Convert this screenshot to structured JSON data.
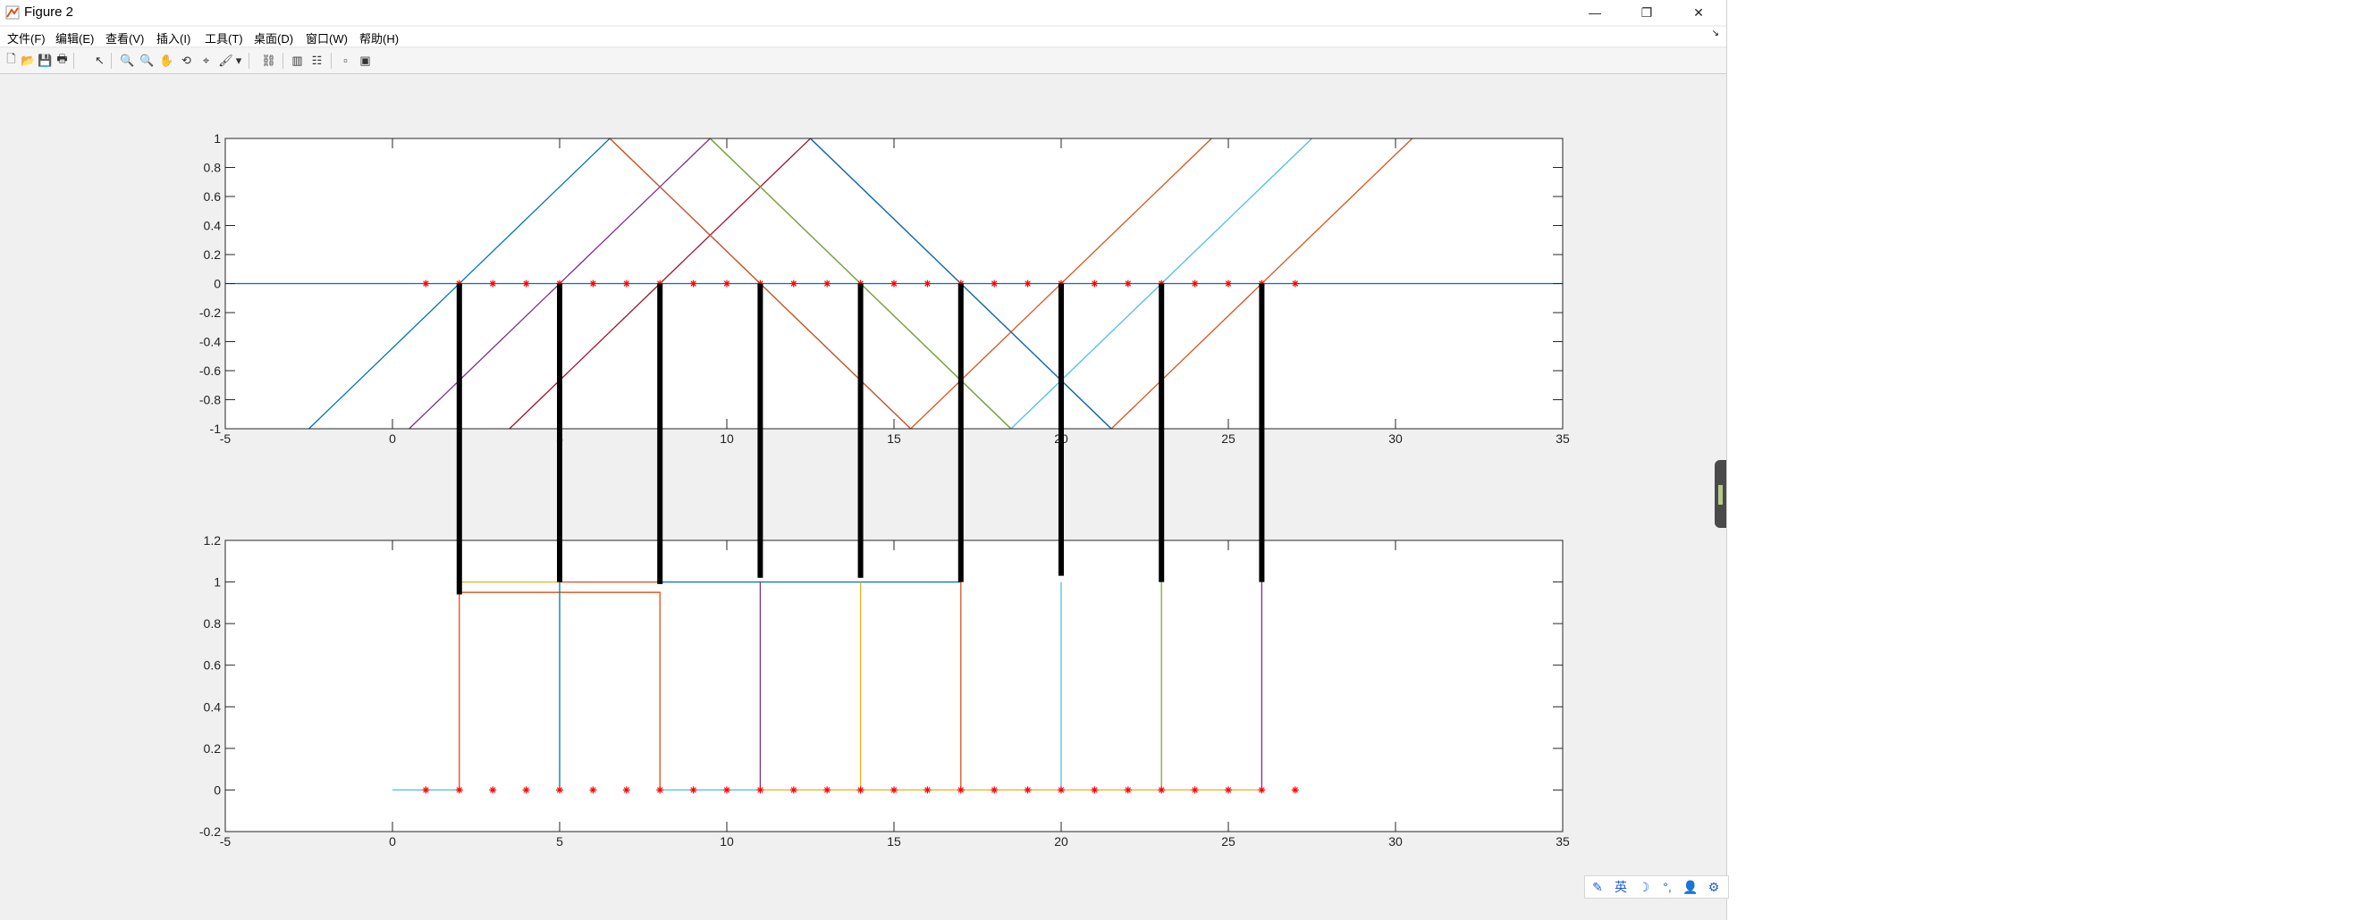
{
  "window": {
    "title": "Figure 2",
    "controls": {
      "minimize": "—",
      "restore": "❐",
      "close": "✕"
    }
  },
  "menu": {
    "items": [
      "文件(F)",
      "编辑(E)",
      "查看(V)",
      "插入(I)",
      "工具(T)",
      "桌面(D)",
      "窗口(W)",
      "帮助(H)"
    ],
    "overflow_arrow": "↘"
  },
  "toolbar": {
    "icons": [
      "new-figure-icon",
      "open-file-icon",
      "save-icon",
      "print-icon",
      "edit-plot-arrow-icon",
      "zoom-in-icon",
      "zoom-out-icon",
      "pan-hand-icon",
      "rotate-3d-icon",
      "data-cursor-icon",
      "brush-icon",
      "brush-dropdown-icon",
      "link-plot-icon",
      "insert-colorbar-icon",
      "insert-legend-icon",
      "hide-plot-tools-icon",
      "show-plot-tools-icon"
    ],
    "glyphs": [
      "🗋",
      "📂",
      "💾",
      "🖶",
      "↖",
      "🔍",
      "🔍",
      "✋",
      "⟲",
      "⌖",
      "🖌",
      "▾",
      "⛓",
      "▥",
      "☷",
      "▫",
      "▣"
    ]
  },
  "ime_bar": {
    "icons": [
      "pen-icon",
      "chinese-mode-icon",
      "moon-icon",
      "punctuation-icon",
      "user-icon",
      "settings-icon"
    ],
    "glyphs": [
      "✎",
      "英",
      "☽",
      "°,",
      "👤",
      "⚙"
    ]
  },
  "colors": {
    "blue": "#0072BD",
    "orange": "#D95319",
    "yellow": "#EDB120",
    "purple": "#7E2F8E",
    "green": "#77AC30",
    "cyan": "#4DBEEE",
    "red": "#A2142F",
    "marker": "#FF0000",
    "connector": "#000000"
  },
  "chart_data": [
    {
      "type": "line",
      "title": "",
      "xlabel": "",
      "ylabel": "",
      "xlim": [
        -5,
        35
      ],
      "ylim": [
        -1,
        1
      ],
      "x_ticks": [
        "-5",
        "0",
        "5",
        "10",
        "15",
        "20",
        "25",
        "30",
        "35"
      ],
      "y_ticks": [
        "-1",
        "-0.8",
        "-0.6",
        "-0.4",
        "-0.2",
        "0",
        "0.2",
        "0.4",
        "0.6",
        "0.8",
        "1"
      ],
      "series": [
        {
          "color": "blue",
          "x": [
            -5,
            35
          ],
          "y": [
            0,
            0
          ]
        },
        {
          "color": "blue",
          "x": [
            -2.5,
            6.5,
            15.5
          ],
          "y": [
            -1,
            1,
            -1
          ]
        },
        {
          "color": "purple",
          "x": [
            0.5,
            9.5,
            18.5
          ],
          "y": [
            -1,
            1,
            -1
          ]
        },
        {
          "color": "red",
          "x": [
            3.5,
            12.5,
            21.5
          ],
          "y": [
            -1,
            1,
            -1
          ]
        },
        {
          "color": "orange",
          "x": [
            6.5,
            15.5,
            24.5
          ],
          "y": [
            1,
            -1,
            1
          ]
        },
        {
          "color": "green",
          "x": [
            9.5,
            18.5
          ],
          "y": [
            1,
            -1
          ]
        },
        {
          "color": "blue",
          "x": [
            12.5,
            21.5
          ],
          "y": [
            1,
            -1
          ]
        },
        {
          "color": "cyan",
          "x": [
            18.5,
            27.5
          ],
          "y": [
            -1,
            1
          ]
        },
        {
          "color": "orange",
          "x": [
            21.5,
            30.5
          ],
          "y": [
            -1,
            1
          ]
        }
      ],
      "markers": {
        "color": "marker",
        "x": [
          1,
          2,
          3,
          4,
          5,
          6,
          7,
          8,
          9,
          10,
          11,
          12,
          13,
          14,
          15,
          16,
          17,
          18,
          19,
          20,
          21,
          22,
          23,
          24,
          25,
          26,
          27
        ],
        "y": [
          0,
          0,
          0,
          0,
          0,
          0,
          0,
          0,
          0,
          0,
          0,
          0,
          0,
          0,
          0,
          0,
          0,
          0,
          0,
          0,
          0,
          0,
          0,
          0,
          0,
          0,
          0
        ]
      }
    },
    {
      "type": "line",
      "title": "",
      "xlabel": "",
      "ylabel": "",
      "xlim": [
        -5,
        35
      ],
      "ylim": [
        -0.2,
        1.2
      ],
      "x_ticks": [
        "-5",
        "0",
        "5",
        "10",
        "15",
        "20",
        "25",
        "30",
        "35"
      ],
      "y_ticks": [
        "-0.2",
        "0",
        "0.2",
        "0.4",
        "0.6",
        "0.8",
        "1",
        "1.2"
      ],
      "series": [
        {
          "color": "cyan",
          "x": [
            0,
            2
          ],
          "y": [
            0,
            0
          ]
        },
        {
          "color": "orange",
          "x": [
            2,
            2,
            8,
            8
          ],
          "y": [
            0,
            0.95,
            0.95,
            0
          ]
        },
        {
          "color": "yellow",
          "x": [
            2,
            5
          ],
          "y": [
            1,
            1
          ]
        },
        {
          "color": "orange",
          "x": [
            5,
            8
          ],
          "y": [
            1,
            1
          ]
        },
        {
          "color": "blue",
          "x": [
            5,
            5
          ],
          "y": [
            0,
            1
          ]
        },
        {
          "color": "blue",
          "x": [
            8,
            17
          ],
          "y": [
            1,
            1
          ]
        },
        {
          "color": "purple",
          "x": [
            11,
            11
          ],
          "y": [
            0,
            1
          ]
        },
        {
          "color": "yellow",
          "x": [
            14,
            14
          ],
          "y": [
            0,
            1
          ]
        },
        {
          "color": "orange",
          "x": [
            17,
            17
          ],
          "y": [
            0,
            1
          ]
        },
        {
          "color": "cyan",
          "x": [
            20,
            20
          ],
          "y": [
            0,
            1
          ]
        },
        {
          "color": "green",
          "x": [
            23,
            23
          ],
          "y": [
            0,
            1
          ]
        },
        {
          "color": "purple",
          "x": [
            26,
            26
          ],
          "y": [
            0,
            1
          ]
        },
        {
          "color": "yellow",
          "x": [
            11,
            26
          ],
          "y": [
            0,
            0
          ]
        },
        {
          "color": "cyan",
          "x": [
            8,
            11
          ],
          "y": [
            0,
            0
          ]
        }
      ],
      "markers": {
        "color": "marker",
        "x": [
          1,
          2,
          3,
          4,
          5,
          6,
          7,
          8,
          9,
          10,
          11,
          12,
          13,
          14,
          15,
          16,
          17,
          18,
          19,
          20,
          21,
          22,
          23,
          24,
          25,
          26,
          27
        ],
        "y": [
          0,
          0,
          0,
          0,
          0,
          0,
          0,
          0,
          0,
          0,
          0,
          0,
          0,
          0,
          0,
          0,
          0,
          0,
          0,
          0,
          0,
          0,
          0,
          0,
          0,
          0,
          0
        ]
      }
    }
  ],
  "connectors": {
    "color": "connector",
    "x": [
      2,
      5,
      8,
      11,
      14,
      17,
      20,
      23,
      26
    ],
    "top_y": 0,
    "bottom_y": [
      0.94,
      1,
      0.99,
      1.02,
      1.02,
      1,
      1.03,
      1,
      1
    ]
  }
}
